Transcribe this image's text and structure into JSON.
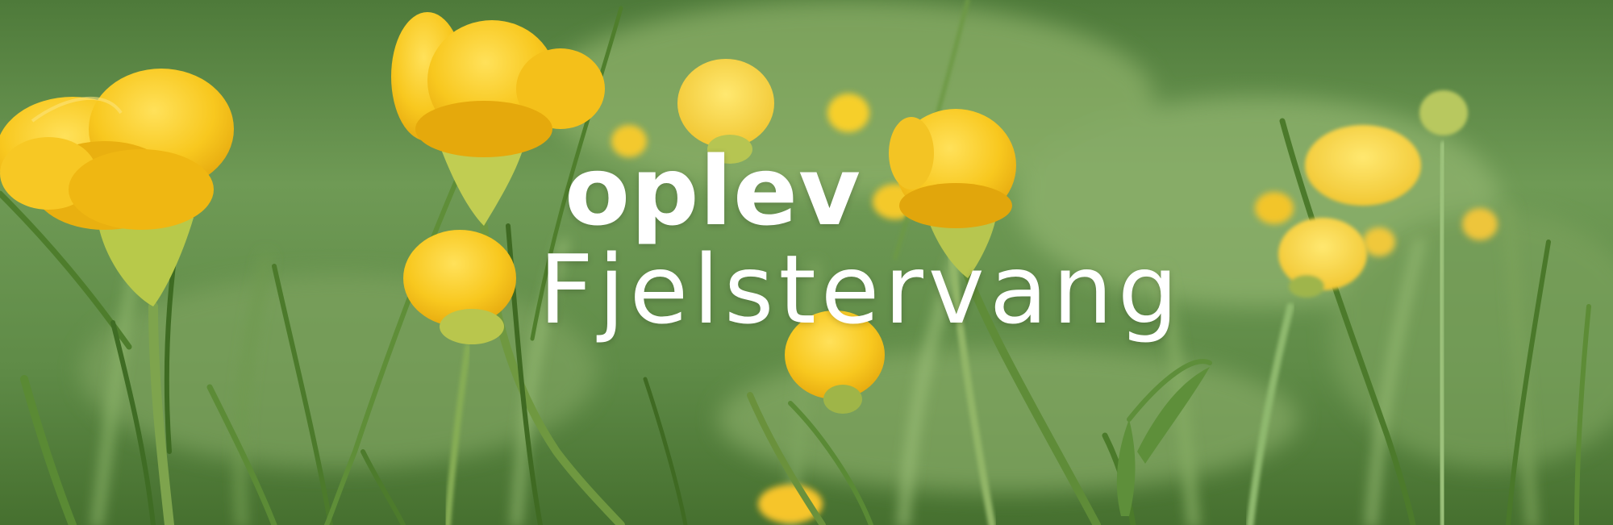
{
  "banner": {
    "headline": "oplev",
    "place_name": "Fjelstervang"
  },
  "colors": {
    "text": "#ffffff",
    "grass_dark": "#3f6a2d",
    "grass_light": "#a8c77d",
    "flower_yellow": "#f6c21c"
  }
}
